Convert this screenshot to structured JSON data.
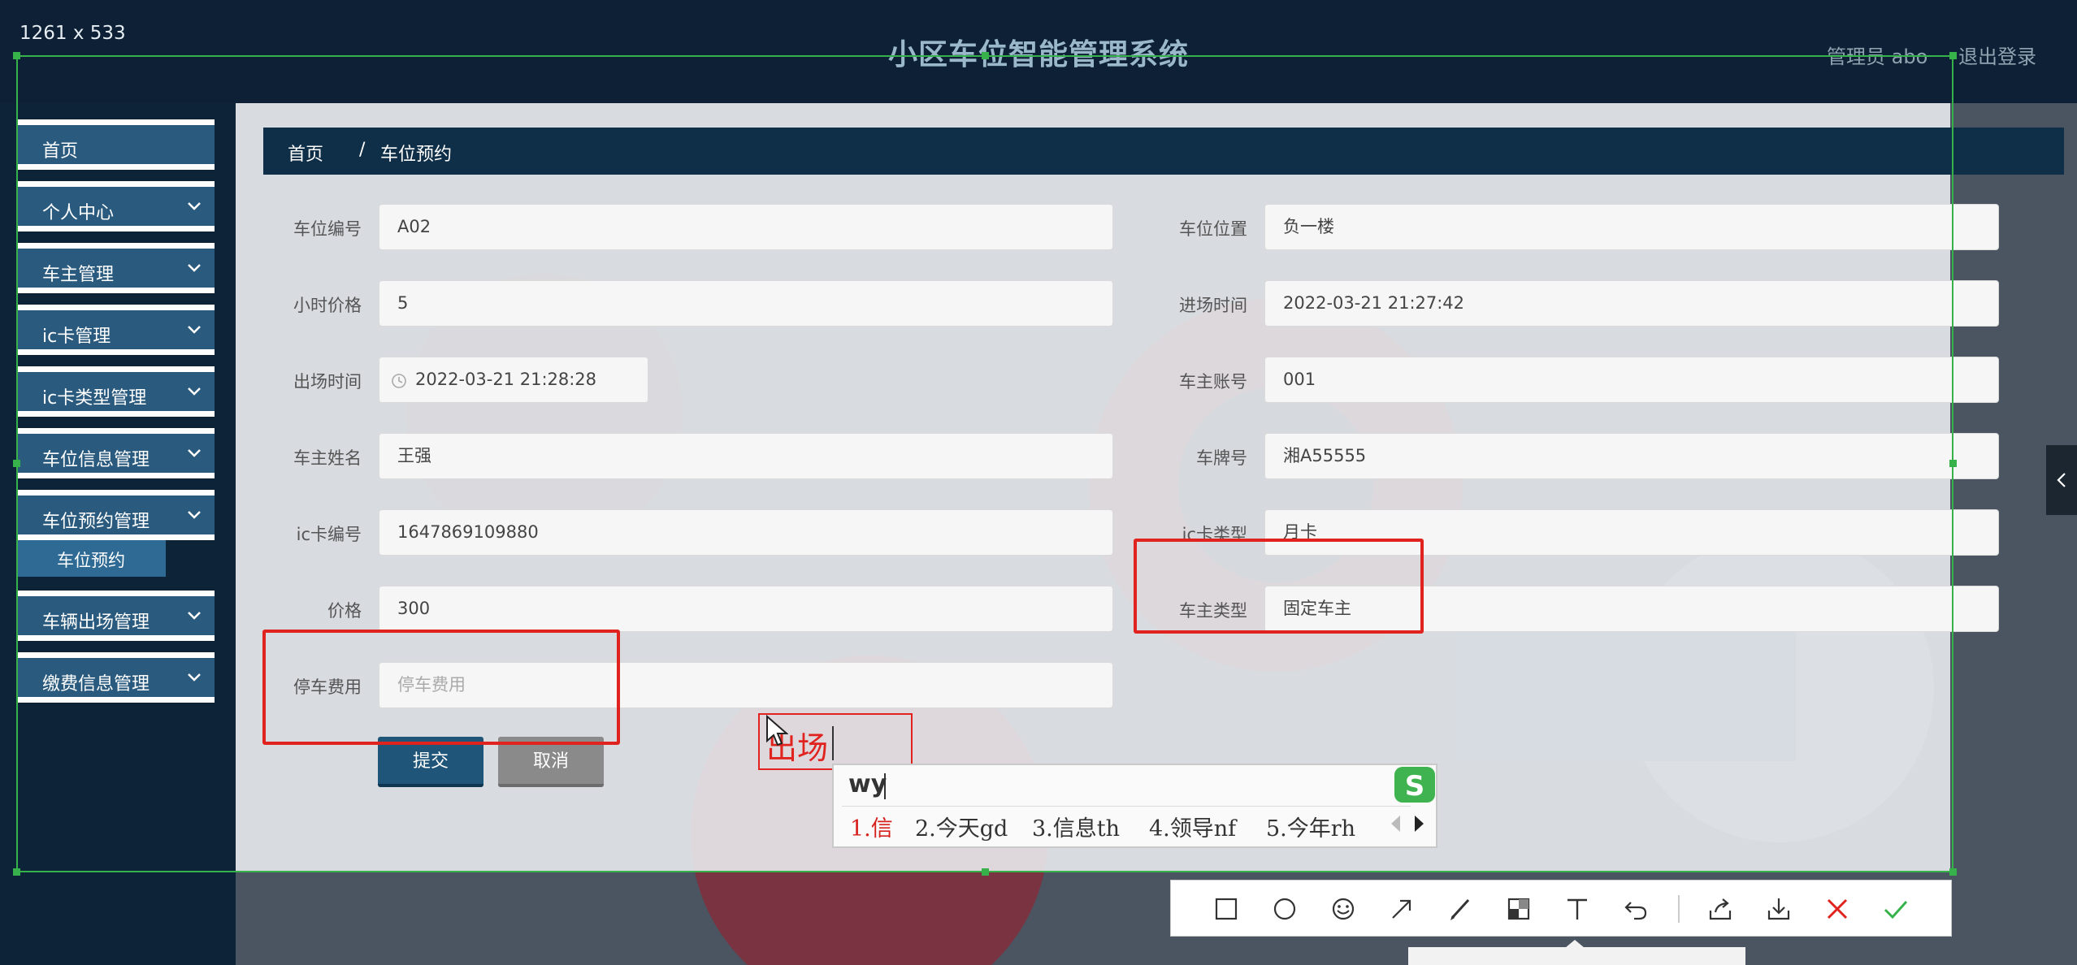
{
  "header": {
    "dimensions": "1261 x 533",
    "title": "小区车位智能管理系统",
    "admin": "管理员 abo",
    "logout": "退出登录"
  },
  "sidebar": {
    "items": [
      {
        "label": "首页"
      },
      {
        "label": "个人中心"
      },
      {
        "label": "车主管理"
      },
      {
        "label": "ic卡管理"
      },
      {
        "label": "ic卡类型管理"
      },
      {
        "label": "车位信息管理"
      },
      {
        "label": "车位预约管理"
      },
      {
        "label": "车辆出场管理"
      },
      {
        "label": "缴费信息管理"
      }
    ],
    "submenu": "车位预约"
  },
  "breadcrumb": {
    "home": "首页",
    "separator": "/",
    "current": "车位预约"
  },
  "form": {
    "space_no": {
      "label": "车位编号",
      "value": "A02"
    },
    "location": {
      "label": "车位位置",
      "value": "负一楼"
    },
    "hour_price": {
      "label": "小时价格",
      "value": "5"
    },
    "entry_time": {
      "label": "进场时间",
      "value": "2022-03-21 21:27:42"
    },
    "exit_time": {
      "label": "出场时间",
      "value": "2022-03-21 21:28:28"
    },
    "owner_account": {
      "label": "车主账号",
      "value": "001"
    },
    "owner_name": {
      "label": "车主姓名",
      "value": "王强"
    },
    "plate": {
      "label": "车牌号",
      "value": "湘A55555"
    },
    "card_no": {
      "label": "ic卡编号",
      "value": "1647869109880"
    },
    "card_type": {
      "label": "ic卡类型",
      "value": "月卡"
    },
    "price": {
      "label": "价格",
      "value": "300"
    },
    "owner_type": {
      "label": "车主类型",
      "value": "固定车主"
    },
    "parking_fee": {
      "label": "停车费用",
      "placeholder": "停车费用"
    },
    "submit": "提交",
    "cancel": "取消"
  },
  "annotation": {
    "text": "出场"
  },
  "ime": {
    "composition": "wy",
    "candidates": [
      "1.信",
      "2.今天gd",
      "3.信息th",
      "4.领导nf",
      "5.今年rh"
    ]
  },
  "toolbar": {
    "tools": [
      "rectangle-icon",
      "ellipse-icon",
      "emoji-icon",
      "arrow-icon",
      "pen-icon",
      "mosaic-icon",
      "text-icon",
      "undo-icon",
      "share-icon",
      "download-icon",
      "close-icon",
      "confirm-icon"
    ]
  },
  "colors": {
    "header_bg": "#0d2035",
    "menu_bg": "#2a5a7e",
    "accent_red": "#e0231e",
    "selection_green": "#37b24a",
    "submit_bg": "#1e5578"
  }
}
